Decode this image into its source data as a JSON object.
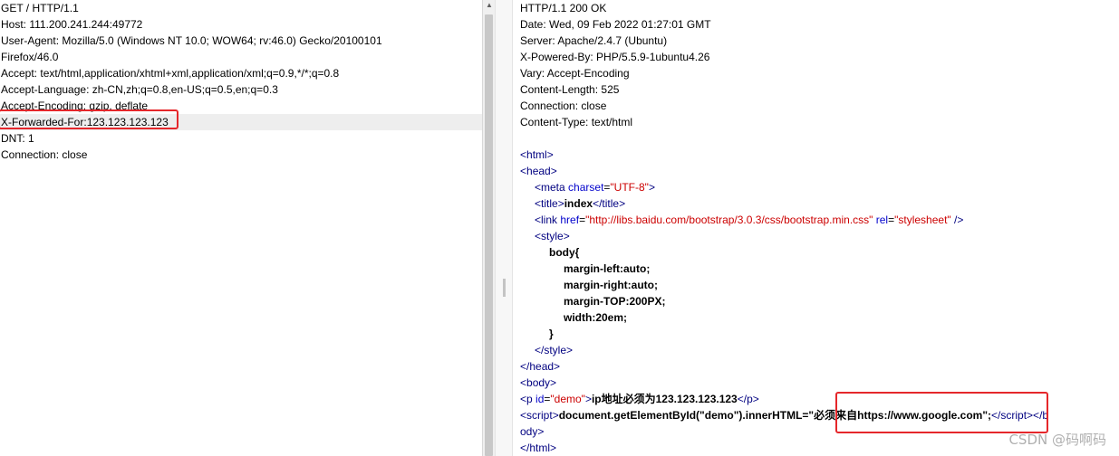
{
  "request": {
    "lines": [
      "GET / HTTP/1.1",
      "Host: 111.200.241.244:49772",
      "User-Agent: Mozilla/5.0 (Windows NT 10.0; WOW64; rv:46.0) Gecko/20100101",
      "Firefox/46.0",
      "Accept: text/html,application/xhtml+xml,application/xml;q=0.9,*/*;q=0.8",
      "Accept-Language: zh-CN,zh;q=0.8,en-US;q=0.5,en;q=0.3",
      "Accept-Encoding: gzip, deflate",
      "X-Forwarded-For:123.123.123.123",
      "DNT: 1",
      "Connection: close"
    ]
  },
  "response": {
    "headers": [
      "HTTP/1.1 200 OK",
      "Date: Wed, 09 Feb 2022 01:27:01 GMT",
      "Server: Apache/2.4.7 (Ubuntu)",
      "X-Powered-By: PHP/5.5.9-1ubuntu4.26",
      "Vary: Accept-Encoding",
      "Content-Length: 525",
      "Connection: close",
      "Content-Type: text/html"
    ],
    "html": {
      "tag_html": "html",
      "tag_head": "head",
      "tag_meta": "meta",
      "attr_charset": "charset",
      "val_charset": "\"UTF-8\"",
      "tag_title": "title",
      "title_text": "index",
      "tag_link": "link",
      "attr_href": "href",
      "val_href": "\"http://libs.baidu.com/bootstrap/3.0.3/css/bootstrap.min.css\"",
      "attr_rel": "rel",
      "val_rel": "\"stylesheet\"",
      "tag_style": "style",
      "css_selector": "body{",
      "css_rules": [
        "margin-left:auto;",
        "margin-right:auto;",
        "margin-TOP:200PX;",
        "width:20em;"
      ],
      "css_close": "}",
      "tag_body": "body",
      "tag_p": "p",
      "attr_id": "id",
      "val_id": "\"demo\"",
      "p_text": "ip地址必须为123.123.123.123",
      "tag_script": "script",
      "script_text": "document.getElementById(\"demo\").innerHTML=\"必须来自https://www.google.com\";",
      "wrap_tail": "ody>"
    }
  },
  "watermark": "CSDN @码啊码"
}
